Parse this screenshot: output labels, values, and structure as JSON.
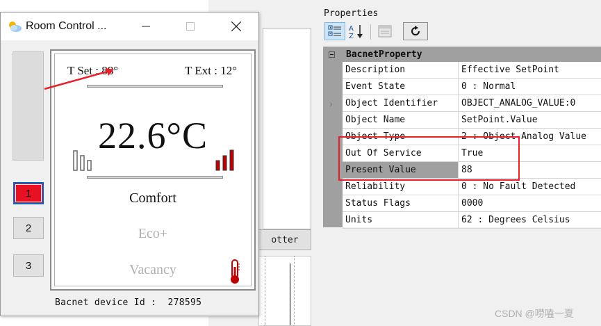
{
  "window": {
    "title": "Room Control ...",
    "minimize_icon": "minimize-icon",
    "maximize_icon": "maximize-icon",
    "close_icon": "close-icon"
  },
  "side_buttons": [
    {
      "label": "1",
      "active": true
    },
    {
      "label": "2",
      "active": false
    },
    {
      "label": "3",
      "active": false
    }
  ],
  "thermostat": {
    "t_set": "T Set : 88°",
    "t_ext": "T Ext : 12°",
    "temperature": "22.6°C",
    "modes": [
      {
        "label": "Comfort",
        "color": "#111111"
      },
      {
        "label": "Eco+",
        "color": "#b0b0b0"
      },
      {
        "label": "Vacancy",
        "color": "#b0b0b0"
      }
    ],
    "fan_levels": {
      "left_bars": 3,
      "right_bars": 3,
      "right_color": "#c00000"
    },
    "thermometer_icon": "thermometer-icon"
  },
  "device": {
    "label": "Bacnet device Id :",
    "id": "278595"
  },
  "background": {
    "plotter_button": "otter"
  },
  "properties": {
    "title": "Properties",
    "toolbar": [
      "categorized-icon",
      "alphabetical-icon",
      "property-pages-icon",
      "refresh-icon"
    ],
    "category": "BacnetProperty",
    "rows": [
      {
        "key": "Description",
        "value": "Effective SetPoint"
      },
      {
        "key": "Event State",
        "value": "0 : Normal"
      },
      {
        "key": "Object Identifier",
        "value": "OBJECT_ANALOG_VALUE:0"
      },
      {
        "key": "Object Name",
        "value": "SetPoint.Value"
      },
      {
        "key": "Object Type",
        "value": "2 : Object Analog Value"
      },
      {
        "key": "Out Of Service",
        "value": "True"
      },
      {
        "key": "Present Value",
        "value": "88"
      },
      {
        "key": "Reliability",
        "value": "0 : No Fault Detected"
      },
      {
        "key": "Status Flags",
        "value": "0000"
      },
      {
        "key": "Units",
        "value": "62 : Degrees Celsius"
      }
    ],
    "selected_row": 6
  },
  "annotations": {
    "highlight_color": "#e8202a"
  },
  "watermark": "CSDN @唠嗑一夏"
}
